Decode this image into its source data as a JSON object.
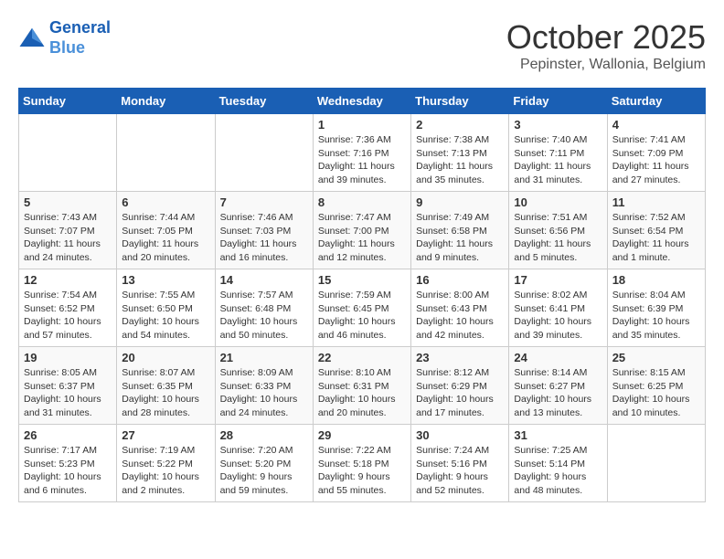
{
  "header": {
    "logo_line1": "General",
    "logo_line2": "Blue",
    "month": "October 2025",
    "location": "Pepinster, Wallonia, Belgium"
  },
  "days_of_week": [
    "Sunday",
    "Monday",
    "Tuesday",
    "Wednesday",
    "Thursday",
    "Friday",
    "Saturday"
  ],
  "weeks": [
    [
      {
        "day": "",
        "empty": true
      },
      {
        "day": "",
        "empty": true
      },
      {
        "day": "",
        "empty": true
      },
      {
        "day": "1",
        "sunrise": "7:36 AM",
        "sunset": "7:16 PM",
        "daylight": "11 hours and 39 minutes."
      },
      {
        "day": "2",
        "sunrise": "7:38 AM",
        "sunset": "7:13 PM",
        "daylight": "11 hours and 35 minutes."
      },
      {
        "day": "3",
        "sunrise": "7:40 AM",
        "sunset": "7:11 PM",
        "daylight": "11 hours and 31 minutes."
      },
      {
        "day": "4",
        "sunrise": "7:41 AM",
        "sunset": "7:09 PM",
        "daylight": "11 hours and 27 minutes."
      }
    ],
    [
      {
        "day": "5",
        "sunrise": "7:43 AM",
        "sunset": "7:07 PM",
        "daylight": "11 hours and 24 minutes."
      },
      {
        "day": "6",
        "sunrise": "7:44 AM",
        "sunset": "7:05 PM",
        "daylight": "11 hours and 20 minutes."
      },
      {
        "day": "7",
        "sunrise": "7:46 AM",
        "sunset": "7:03 PM",
        "daylight": "11 hours and 16 minutes."
      },
      {
        "day": "8",
        "sunrise": "7:47 AM",
        "sunset": "7:00 PM",
        "daylight": "11 hours and 12 minutes."
      },
      {
        "day": "9",
        "sunrise": "7:49 AM",
        "sunset": "6:58 PM",
        "daylight": "11 hours and 9 minutes."
      },
      {
        "day": "10",
        "sunrise": "7:51 AM",
        "sunset": "6:56 PM",
        "daylight": "11 hours and 5 minutes."
      },
      {
        "day": "11",
        "sunrise": "7:52 AM",
        "sunset": "6:54 PM",
        "daylight": "11 hours and 1 minute."
      }
    ],
    [
      {
        "day": "12",
        "sunrise": "7:54 AM",
        "sunset": "6:52 PM",
        "daylight": "10 hours and 57 minutes."
      },
      {
        "day": "13",
        "sunrise": "7:55 AM",
        "sunset": "6:50 PM",
        "daylight": "10 hours and 54 minutes."
      },
      {
        "day": "14",
        "sunrise": "7:57 AM",
        "sunset": "6:48 PM",
        "daylight": "10 hours and 50 minutes."
      },
      {
        "day": "15",
        "sunrise": "7:59 AM",
        "sunset": "6:45 PM",
        "daylight": "10 hours and 46 minutes."
      },
      {
        "day": "16",
        "sunrise": "8:00 AM",
        "sunset": "6:43 PM",
        "daylight": "10 hours and 42 minutes."
      },
      {
        "day": "17",
        "sunrise": "8:02 AM",
        "sunset": "6:41 PM",
        "daylight": "10 hours and 39 minutes."
      },
      {
        "day": "18",
        "sunrise": "8:04 AM",
        "sunset": "6:39 PM",
        "daylight": "10 hours and 35 minutes."
      }
    ],
    [
      {
        "day": "19",
        "sunrise": "8:05 AM",
        "sunset": "6:37 PM",
        "daylight": "10 hours and 31 minutes."
      },
      {
        "day": "20",
        "sunrise": "8:07 AM",
        "sunset": "6:35 PM",
        "daylight": "10 hours and 28 minutes."
      },
      {
        "day": "21",
        "sunrise": "8:09 AM",
        "sunset": "6:33 PM",
        "daylight": "10 hours and 24 minutes."
      },
      {
        "day": "22",
        "sunrise": "8:10 AM",
        "sunset": "6:31 PM",
        "daylight": "10 hours and 20 minutes."
      },
      {
        "day": "23",
        "sunrise": "8:12 AM",
        "sunset": "6:29 PM",
        "daylight": "10 hours and 17 minutes."
      },
      {
        "day": "24",
        "sunrise": "8:14 AM",
        "sunset": "6:27 PM",
        "daylight": "10 hours and 13 minutes."
      },
      {
        "day": "25",
        "sunrise": "8:15 AM",
        "sunset": "6:25 PM",
        "daylight": "10 hours and 10 minutes."
      }
    ],
    [
      {
        "day": "26",
        "sunrise": "7:17 AM",
        "sunset": "5:23 PM",
        "daylight": "10 hours and 6 minutes."
      },
      {
        "day": "27",
        "sunrise": "7:19 AM",
        "sunset": "5:22 PM",
        "daylight": "10 hours and 2 minutes."
      },
      {
        "day": "28",
        "sunrise": "7:20 AM",
        "sunset": "5:20 PM",
        "daylight": "9 hours and 59 minutes."
      },
      {
        "day": "29",
        "sunrise": "7:22 AM",
        "sunset": "5:18 PM",
        "daylight": "9 hours and 55 minutes."
      },
      {
        "day": "30",
        "sunrise": "7:24 AM",
        "sunset": "5:16 PM",
        "daylight": "9 hours and 52 minutes."
      },
      {
        "day": "31",
        "sunrise": "7:25 AM",
        "sunset": "5:14 PM",
        "daylight": "9 hours and 48 minutes."
      },
      {
        "day": "",
        "empty": true
      }
    ]
  ]
}
